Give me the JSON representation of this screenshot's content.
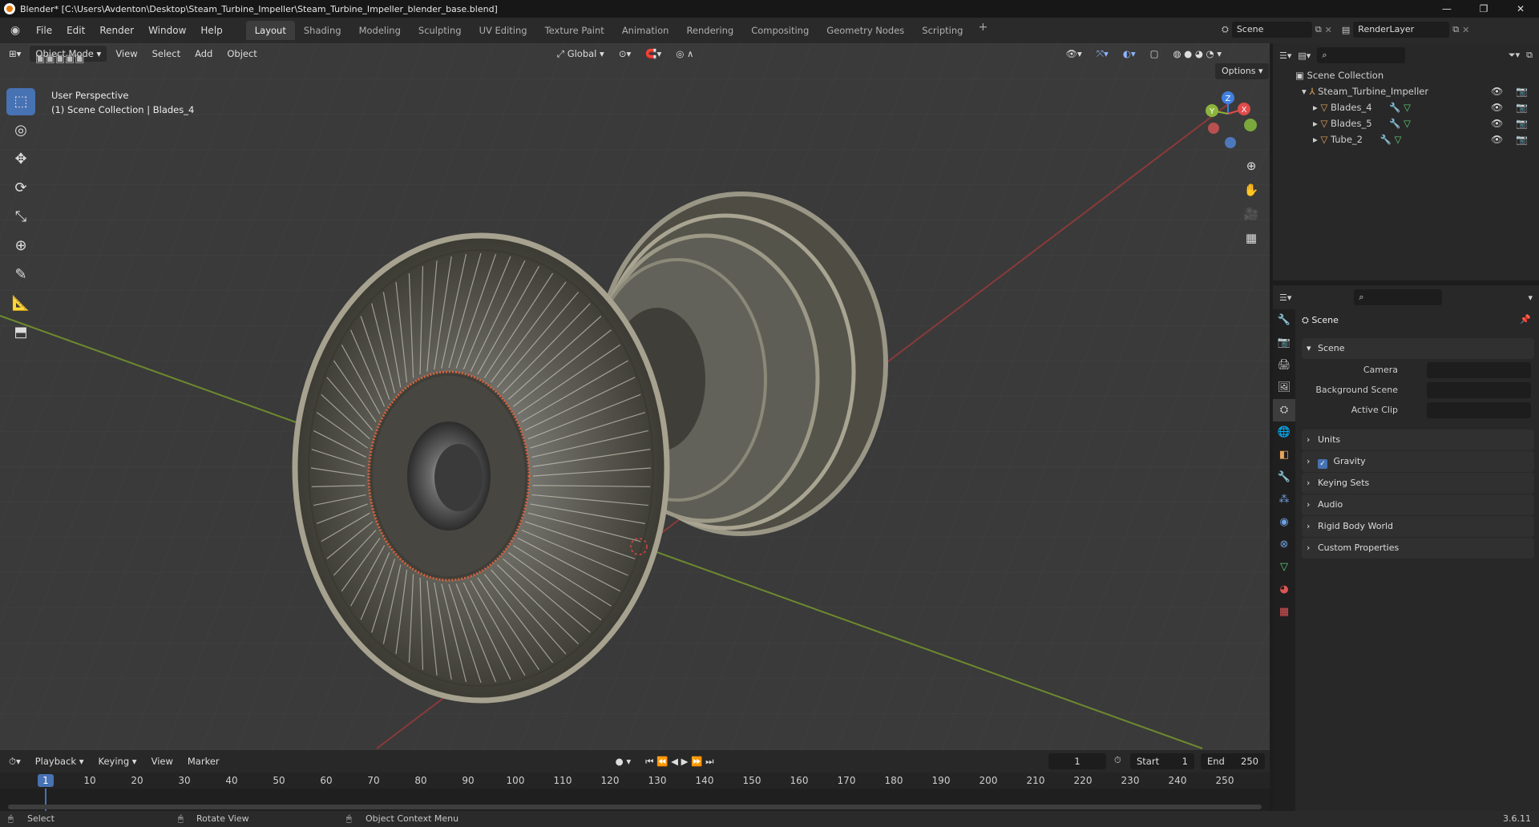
{
  "window": {
    "title": "Blender* [C:\\Users\\Avdenton\\Desktop\\Steam_Turbine_Impeller\\Steam_Turbine_Impeller_blender_base.blend]",
    "minimize": "—",
    "maximize": "❐",
    "close": "✕"
  },
  "menu": [
    "File",
    "Edit",
    "Render",
    "Window",
    "Help"
  ],
  "workspaces": [
    "Layout",
    "Shading",
    "Modeling",
    "Sculpting",
    "UV Editing",
    "Texture Paint",
    "Animation",
    "Rendering",
    "Compositing",
    "Geometry Nodes",
    "Scripting"
  ],
  "active_workspace": "Layout",
  "scene_name": "Scene",
  "render_layer": "RenderLayer",
  "viewport": {
    "mode": "Object Mode",
    "menus": [
      "View",
      "Select",
      "Add",
      "Object"
    ],
    "orientation": "Global",
    "options": "Options",
    "perspective": "User Perspective",
    "collection_info": "(1) Scene Collection | Blades_4",
    "gizmo": {
      "x": "X",
      "y": "Y",
      "z": "Z"
    }
  },
  "outliner": {
    "root": "Scene Collection",
    "collection": "Steam_Turbine_Impeller",
    "objects": [
      "Blades_4",
      "Blades_5",
      "Tube_2"
    ]
  },
  "properties": {
    "header": "Scene",
    "panel": "Scene",
    "fields": [
      {
        "label": "Camera"
      },
      {
        "label": "Background Scene"
      },
      {
        "label": "Active Clip"
      }
    ],
    "sections": [
      "Units",
      "Gravity",
      "Keying Sets",
      "Audio",
      "Rigid Body World",
      "Custom Properties"
    ]
  },
  "timeline": {
    "menus": [
      "Playback",
      "Keying",
      "View",
      "Marker"
    ],
    "current_frame": "1",
    "start_label": "Start",
    "start": "1",
    "end_label": "End",
    "end": "250",
    "ticks": [
      "10",
      "20",
      "30",
      "40",
      "50",
      "60",
      "70",
      "80",
      "90",
      "100",
      "110",
      "120",
      "130",
      "140",
      "150",
      "160",
      "170",
      "180",
      "190",
      "200",
      "210",
      "220",
      "230",
      "240",
      "250"
    ]
  },
  "status": {
    "select": "Select",
    "rotate": "Rotate View",
    "context": "Object Context Menu",
    "version": "3.6.11"
  },
  "colors": {
    "accent": "#4772b3",
    "x_axis": "#e04b4b",
    "y_axis": "#8cb43c",
    "z_axis": "#3f7fe0"
  }
}
